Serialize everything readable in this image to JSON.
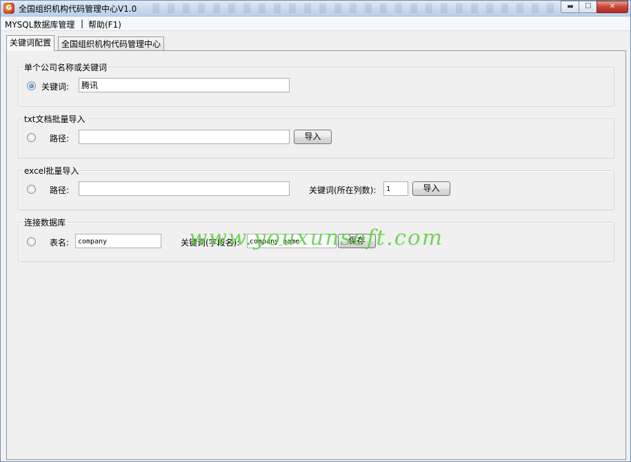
{
  "window": {
    "title": "全国组织机构代码管理中心V1.0",
    "app_icon_glyph": "G",
    "min_glyph": "▬",
    "max_glyph": "☐",
    "close_glyph": "✕"
  },
  "menu": {
    "items": [
      "MYSQL数据库管理",
      "|",
      "帮助(F1)"
    ]
  },
  "tabs": [
    "关键词配置",
    "全国组织机构代码管理中心"
  ],
  "groups": {
    "single": {
      "title": "单个公司名称或关键词",
      "keyword_label": "关键词:",
      "keyword_value": "腾讯"
    },
    "txt": {
      "title": "txt文档批量导入",
      "path_label": "路径:",
      "path_value": "",
      "import_label": "导入"
    },
    "excel": {
      "title": "excel批量导入",
      "path_label": "路径:",
      "path_value": "",
      "column_label": "关键词(所在列数):",
      "column_value": "1",
      "import_label": "导入"
    },
    "db": {
      "title": "连接数据库",
      "table_label": "表名:",
      "table_value": "company",
      "field_label": "关键词(字段名):",
      "field_value": "company_name",
      "save_label": "保存"
    }
  },
  "watermark": "www.youxunsoft.com",
  "colors": {
    "watermark": "#5ad13c",
    "close_button": "#c9463a"
  }
}
